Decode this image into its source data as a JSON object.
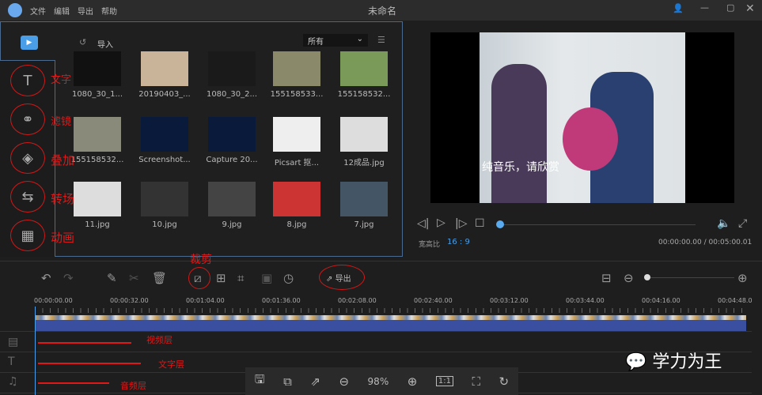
{
  "titlebar": {
    "title": "未命名",
    "menu": [
      "文件",
      "编辑",
      "导出",
      "帮助"
    ]
  },
  "media": {
    "import_label": "导入",
    "filter_value": "所有",
    "items": [
      {
        "name": "1080_30_1...",
        "color": "#111"
      },
      {
        "name": "20190403_...",
        "color": "#c9b49a"
      },
      {
        "name": "1080_30_2...",
        "color": "#1a1a1a"
      },
      {
        "name": "155158533...",
        "color": "#8a8a6a"
      },
      {
        "name": "155158532...",
        "color": "#7a9a5a"
      },
      {
        "name": "155158532...",
        "color": "#8a8a7a"
      },
      {
        "name": "Screenshot...",
        "color": "#0a1a3a"
      },
      {
        "name": "Capture 20...",
        "color": "#0a1a3a"
      },
      {
        "name": "Picsart 抠...",
        "color": "#eee"
      },
      {
        "name": "12成品.jpg",
        "color": "#ddd"
      },
      {
        "name": "11.jpg",
        "color": "#ddd"
      },
      {
        "name": "10.jpg",
        "color": "#333"
      },
      {
        "name": "9.jpg",
        "color": "#444"
      },
      {
        "name": "8.jpg",
        "color": "#c33"
      },
      {
        "name": "7.jpg",
        "color": "#456"
      }
    ]
  },
  "sidebar": [
    {
      "icon": "text-icon",
      "glyph": "T",
      "annotation": "文字"
    },
    {
      "icon": "filter-icon",
      "glyph": "⚭",
      "annotation": "滤镜"
    },
    {
      "icon": "overlay-icon",
      "glyph": "◈",
      "annotation": "叠加"
    },
    {
      "icon": "transition-icon",
      "glyph": "⇆",
      "annotation": "转场"
    },
    {
      "icon": "animation-icon",
      "glyph": "▦",
      "annotation": "动画"
    }
  ],
  "preview": {
    "subtitle": "纯音乐，请欣赏",
    "aspect_label": "宽高比",
    "aspect_value": "16 : 9",
    "time": "00:00:00.00 / 00:05:00.01",
    "progress": 0
  },
  "toolbar": {
    "crop_annotation": "裁剪",
    "export_label": "导出"
  },
  "ruler": [
    "00:00:00.00",
    "00:00:32.00",
    "00:01:04.00",
    "00:01:36.00",
    "00:02:08.00",
    "00:02:40.00",
    "00:03:12.00",
    "00:03:44.00",
    "00:04:16.00",
    "00:04:48.0"
  ],
  "annotations": {
    "video": "视频层",
    "text": "文字层",
    "audio": "音频层"
  },
  "bottombar": {
    "zoom": "98%",
    "ratio": "1:1"
  },
  "watermark": "学力为王",
  "colors": {
    "accent": "#4a9ee8",
    "annotation": "#e01818"
  }
}
